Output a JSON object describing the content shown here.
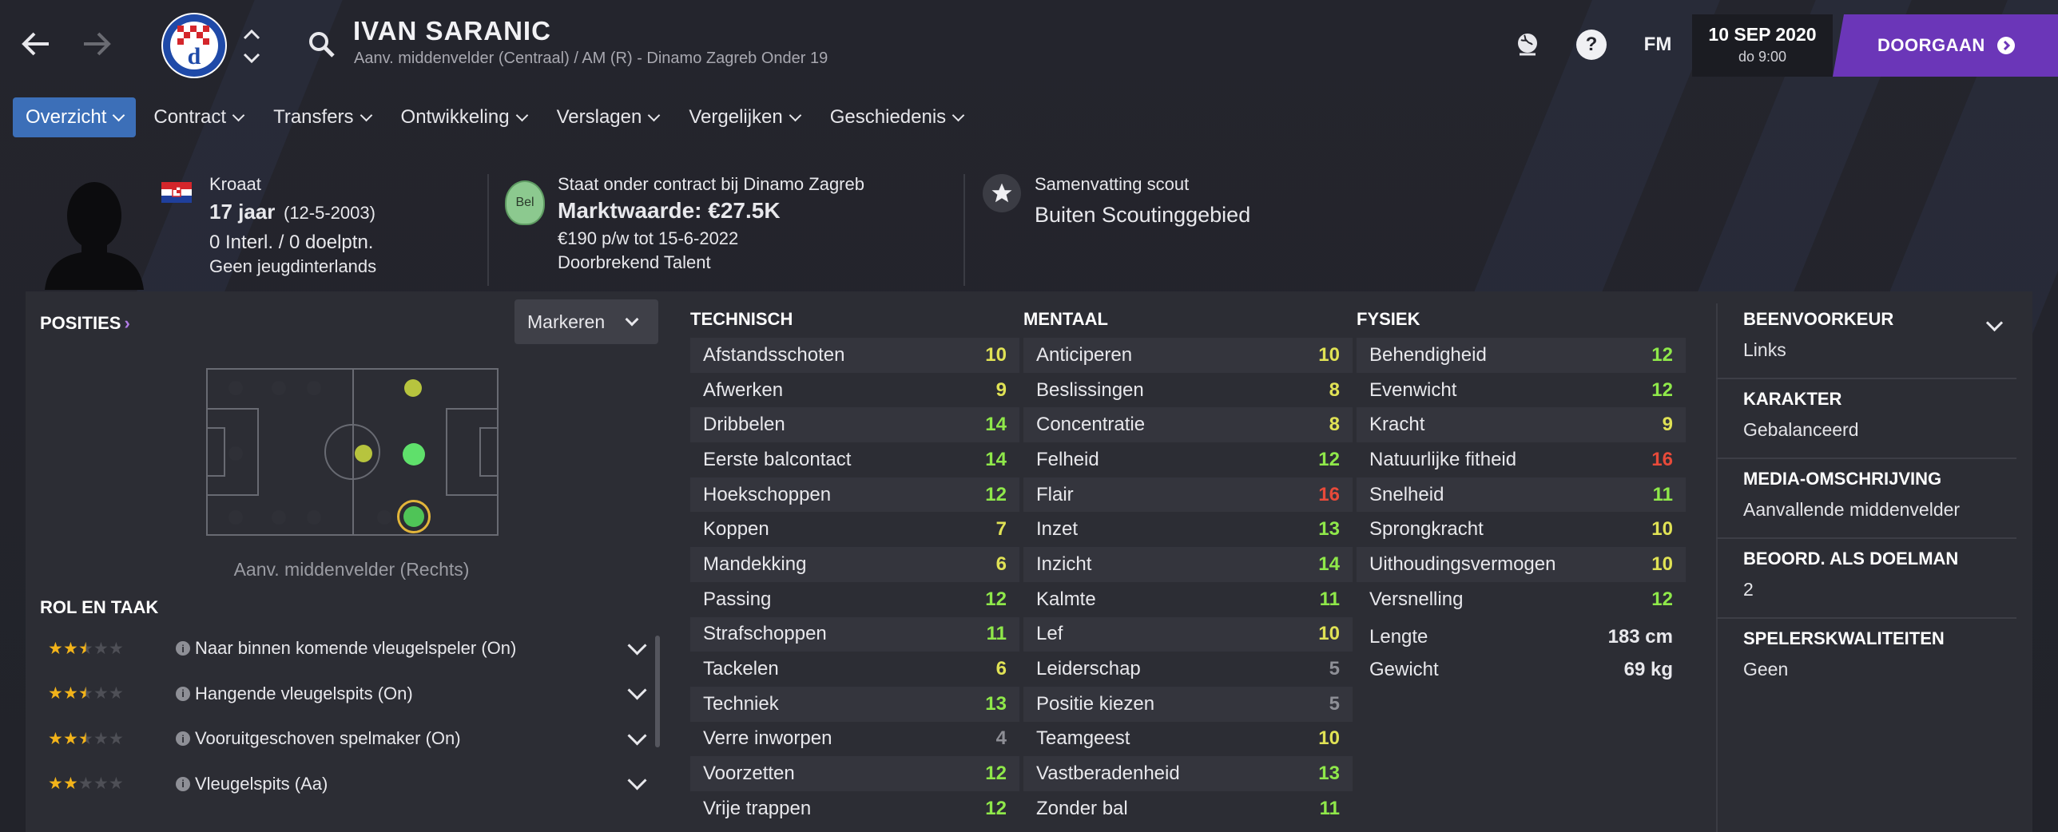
{
  "colors": {
    "accent": "#3c6fb8",
    "continue": "#6b36b8",
    "attr_high": "#8fe84a",
    "attr_mid": "#e0e255",
    "attr_red": "#e84a3a",
    "attr_low": "#8e8f96"
  },
  "header": {
    "name": "IVAN SARANIC",
    "subtitle": "Aanv. middenvelder (Centraal) / AM (R) - Dinamo Zagreb Onder 19",
    "date": "10 SEP 2020",
    "time": "do 9:00",
    "continue_label": "DOORGAAN",
    "fm_label": "FM",
    "help_label": "?",
    "icons": [
      "back-arrow-icon",
      "forward-arrow-icon",
      "club-badge-icon",
      "search-icon",
      "globe-icon",
      "help-icon",
      "fm-logo-icon"
    ]
  },
  "tabs": [
    {
      "label": "Overzicht",
      "active": true
    },
    {
      "label": "Contract",
      "active": false
    },
    {
      "label": "Transfers",
      "active": false
    },
    {
      "label": "Ontwikkeling",
      "active": false
    },
    {
      "label": "Verslagen",
      "active": false
    },
    {
      "label": "Vergelijken",
      "active": false
    },
    {
      "label": "Geschiedenis",
      "active": false
    }
  ],
  "bio": {
    "nationality": "Kroaat",
    "age": "17 jaar",
    "dob": "(12-5-2003)",
    "caps": "0 Interl. / 0 doelptn.",
    "youth_caps": "Geen jeugdinterlands"
  },
  "contract": {
    "badge": "Bel",
    "club_line": "Staat onder contract bij Dinamo Zagreb",
    "value": "Marktwaarde: €27.5K",
    "wage": "€190 p/w tot 15-6-2022",
    "status": "Doorbrekend Talent"
  },
  "scout": {
    "title": "Samenvatting scout",
    "value": "Buiten Scoutinggebied"
  },
  "positions": {
    "title": "POSITIES",
    "dropdown": "Markeren",
    "caption": "Aanv. middenvelder (Rechts)"
  },
  "roles": {
    "title": "ROL EN TAAK",
    "items": [
      {
        "label": "Naar binnen komende vleugelspeler (On)",
        "stars": 2.5
      },
      {
        "label": "Hangende vleugelspits (On)",
        "stars": 2.5
      },
      {
        "label": "Vooruitgeschoven spelmaker (On)",
        "stars": 2.5
      },
      {
        "label": "Vleugelspits (Aa)",
        "stars": 2
      }
    ]
  },
  "technisch": {
    "title": "TECHNISCH",
    "rows": [
      {
        "name": "Afstandsschoten",
        "value": "10"
      },
      {
        "name": "Afwerken",
        "value": "9"
      },
      {
        "name": "Dribbelen",
        "value": "14"
      },
      {
        "name": "Eerste balcontact",
        "value": "14"
      },
      {
        "name": "Hoekschoppen",
        "value": "12"
      },
      {
        "name": "Koppen",
        "value": "7"
      },
      {
        "name": "Mandekking",
        "value": "6"
      },
      {
        "name": "Passing",
        "value": "12"
      },
      {
        "name": "Strafschoppen",
        "value": "11"
      },
      {
        "name": "Tackelen",
        "value": "6"
      },
      {
        "name": "Techniek",
        "value": "13"
      },
      {
        "name": "Verre inworpen",
        "value": "4"
      },
      {
        "name": "Voorzetten",
        "value": "12"
      },
      {
        "name": "Vrije trappen",
        "value": "12"
      }
    ]
  },
  "mentaal": {
    "title": "MENTAAL",
    "rows": [
      {
        "name": "Anticiperen",
        "value": "10"
      },
      {
        "name": "Beslissingen",
        "value": "8"
      },
      {
        "name": "Concentratie",
        "value": "8"
      },
      {
        "name": "Felheid",
        "value": "12"
      },
      {
        "name": "Flair",
        "value": "16"
      },
      {
        "name": "Inzet",
        "value": "13"
      },
      {
        "name": "Inzicht",
        "value": "14"
      },
      {
        "name": "Kalmte",
        "value": "11"
      },
      {
        "name": "Lef",
        "value": "10"
      },
      {
        "name": "Leiderschap",
        "value": "5"
      },
      {
        "name": "Positie kiezen",
        "value": "5"
      },
      {
        "name": "Teamgeest",
        "value": "10"
      },
      {
        "name": "Vastberadenheid",
        "value": "13"
      },
      {
        "name": "Zonder bal",
        "value": "11"
      }
    ]
  },
  "fysiek": {
    "title": "FYSIEK",
    "rows": [
      {
        "name": "Behendigheid",
        "value": "12"
      },
      {
        "name": "Evenwicht",
        "value": "12"
      },
      {
        "name": "Kracht",
        "value": "9"
      },
      {
        "name": "Natuurlijke fitheid",
        "value": "16"
      },
      {
        "name": "Snelheid",
        "value": "11"
      },
      {
        "name": "Sprongkracht",
        "value": "10"
      },
      {
        "name": "Uithoudingsvermogen",
        "value": "10"
      },
      {
        "name": "Versnelling",
        "value": "12"
      }
    ],
    "height_label": "Lengte",
    "height": "183 cm",
    "weight_label": "Gewicht",
    "weight": "69 kg"
  },
  "details": [
    {
      "title": "BEENVOORKEUR",
      "value": "Links"
    },
    {
      "title": "KARAKTER",
      "value": "Gebalanceerd"
    },
    {
      "title": "MEDIA-OMSCHRIJVING",
      "value": "Aanvallende middenvelder"
    },
    {
      "title": "BEOORD. ALS DOELMAN",
      "value": "2"
    },
    {
      "title": "SPELERSKWALITEITEN",
      "value": "Geen"
    }
  ]
}
